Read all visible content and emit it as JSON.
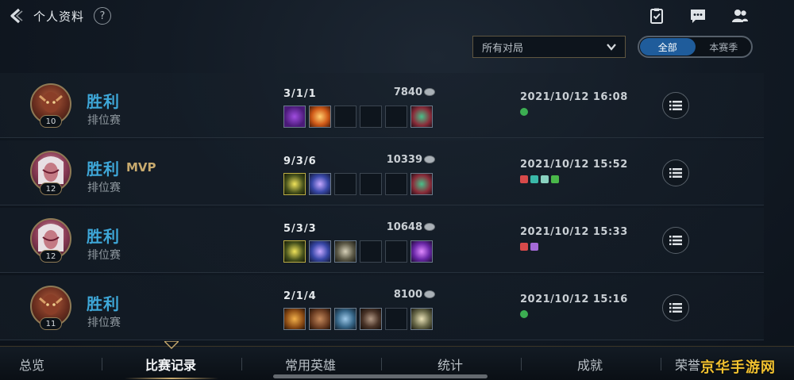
{
  "header": {
    "title": "个人资料",
    "help": "?"
  },
  "filters": {
    "mode_select": "所有对局",
    "segments": [
      {
        "label": "全部",
        "active": true
      },
      {
        "label": "本赛季",
        "active": false
      }
    ]
  },
  "matches": [
    {
      "level": "10",
      "result": "胜利",
      "mvp": "",
      "mode": "排位赛",
      "kda": "3/1/1",
      "gold": "7840",
      "date": "2021/10/12 16:08",
      "items": [
        "purple-crystal-item",
        "flame-blade-item",
        "empty-slot",
        "empty-slot",
        "empty-slot",
        "boots-item"
      ]
    },
    {
      "level": "12",
      "result": "胜利",
      "mvp": "MVP",
      "mode": "排位赛",
      "kda": "9/3/6",
      "gold": "10339",
      "date": "2021/10/12 15:52",
      "items": [
        "triangle-ward-item",
        "rune-blade-item",
        "empty-slot",
        "empty-slot",
        "empty-slot",
        "boots-item"
      ]
    },
    {
      "level": "12",
      "result": "胜利",
      "mvp": "",
      "mode": "排位赛",
      "kda": "5/3/3",
      "gold": "10648",
      "date": "2021/10/12 15:33",
      "items": [
        "triangle-ward-item",
        "rune-blade-item",
        "crossed-swords-item",
        "empty-slot",
        "empty-slot",
        "arcane-orb-item"
      ]
    },
    {
      "level": "11",
      "result": "胜利",
      "mvp": "",
      "mode": "排位赛",
      "kda": "2/1/4",
      "gold": "8100",
      "date": "2021/10/12 15:16",
      "items": [
        "ember-item",
        "brown-potion-item",
        "blue-cape-item",
        "dark-hammer-item",
        "empty-slot",
        "armor-item"
      ]
    }
  ],
  "nav": {
    "items": [
      "总览",
      "比赛记录",
      "常用英雄",
      "统计",
      "成就",
      "荣誉"
    ],
    "active_index": 1
  },
  "watermark": "京华手游网",
  "colors": {
    "victory": "#3ea7d8",
    "mvp": "#c8aa6e",
    "segment_active": "#1f5c9b",
    "accent_gold": "#c8aa6e"
  }
}
